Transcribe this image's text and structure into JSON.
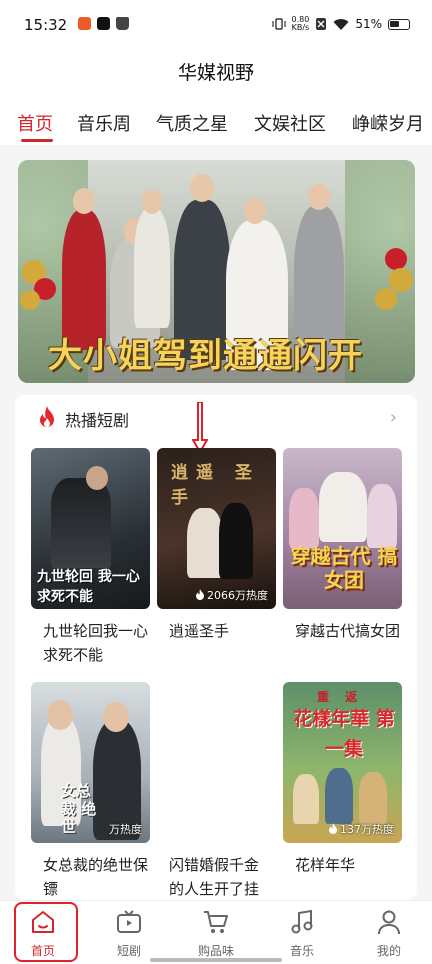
{
  "status_bar": {
    "time": "15:32",
    "speed_value": "0.80",
    "speed_unit": "KB/s",
    "battery": "51%"
  },
  "app": {
    "title": "华媒视野"
  },
  "tabs": [
    {
      "label": "首页",
      "active": true
    },
    {
      "label": "音乐周",
      "active": false
    },
    {
      "label": "气质之星",
      "active": false
    },
    {
      "label": "文娱社区",
      "active": false
    },
    {
      "label": "峥嵘岁月",
      "active": false
    }
  ],
  "banner": {
    "caption": "大小姐驾到通通闪开",
    "slide_count": 5,
    "active_slide": 4
  },
  "section": {
    "title": "热播短剧",
    "icon": "fire-icon",
    "more_icon": "chevron-right-icon"
  },
  "dramas": [
    {
      "title": "九世轮回我一心求死不能",
      "overlay_text": "九世轮回 我一心求死不能",
      "heat": ""
    },
    {
      "title": "逍遥圣手",
      "overlay_text": "逍遥 圣手",
      "heat": "2066万热度"
    },
    {
      "title": "穿越古代搞女团",
      "overlay_text": "穿越古代 搞女团",
      "heat": ""
    },
    {
      "title": "女总裁的绝世保镖",
      "overlay_text": "女总裁 绝世",
      "heat": "万热度"
    },
    {
      "title": "闪错婚假千金的人生开了挂",
      "overlay_text": "",
      "heat": ""
    },
    {
      "title": "花样年华",
      "overlay_text": "花樣年華 第一集",
      "overlay_top": "重 返",
      "heat": "137万热度"
    }
  ],
  "bottom_nav": [
    {
      "label": "首页",
      "icon": "home-icon",
      "active": true
    },
    {
      "label": "短剧",
      "icon": "tv-icon",
      "active": false
    },
    {
      "label": "购品味",
      "icon": "cart-icon",
      "active": false
    },
    {
      "label": "音乐",
      "icon": "music-note-icon",
      "active": false
    },
    {
      "label": "我的",
      "icon": "person-icon",
      "active": false
    }
  ],
  "colors": {
    "accent": "#d6262b",
    "highlight_box": "#e0202a"
  }
}
